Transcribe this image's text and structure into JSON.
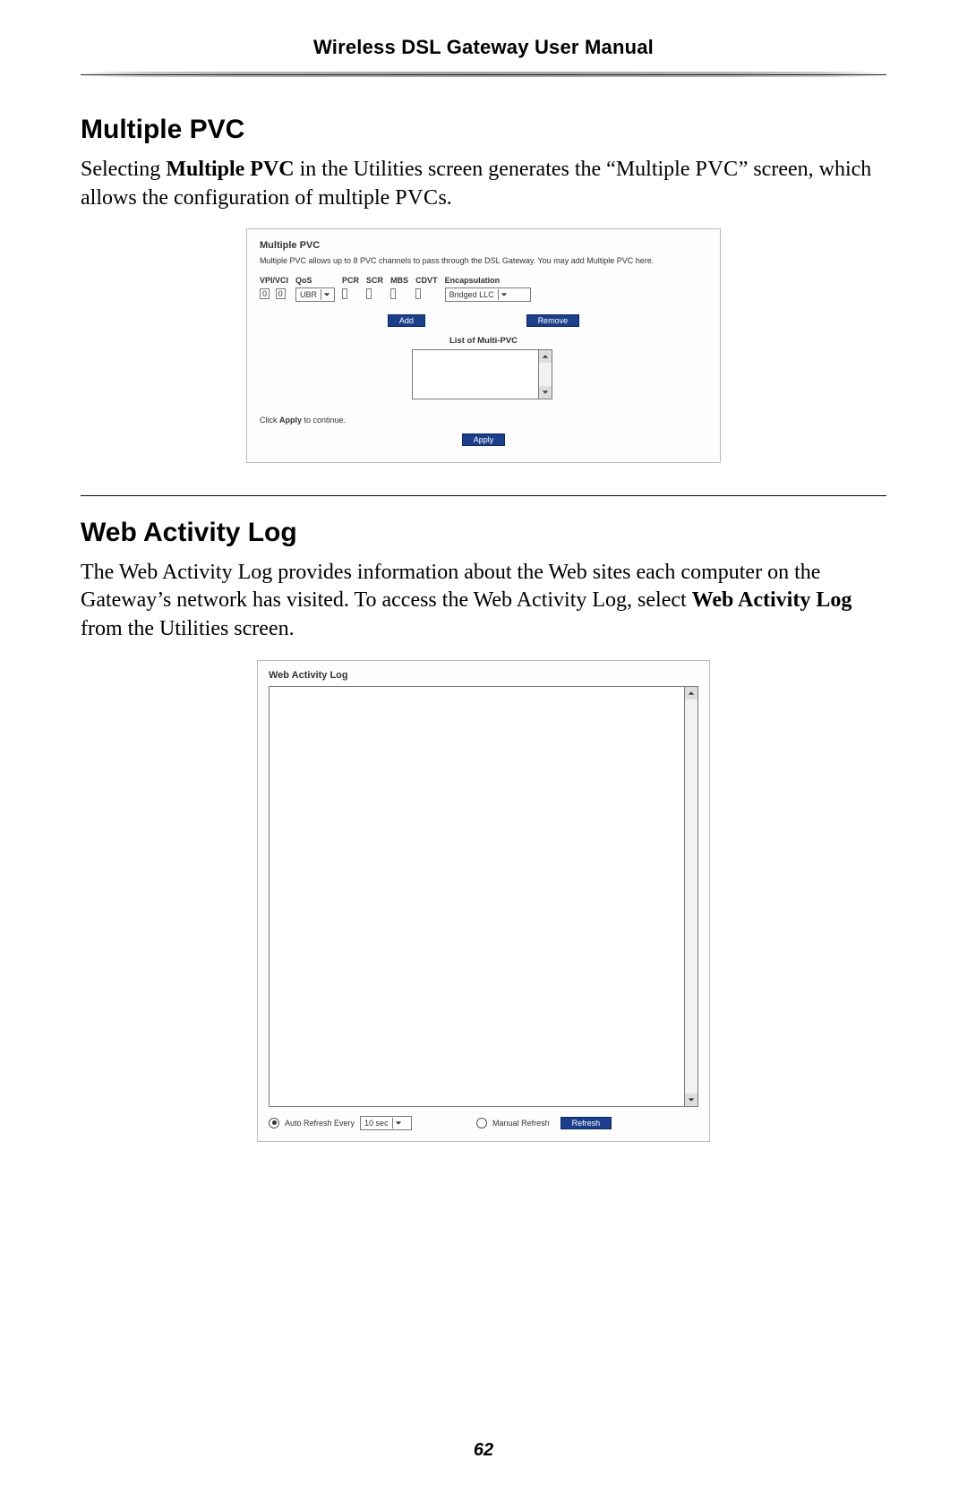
{
  "header": {
    "title": "Wireless DSL Gateway User Manual"
  },
  "page_number": "62",
  "sections": {
    "pvc": {
      "heading": "Multiple PVC",
      "para_a": "Selecting ",
      "para_b_strong": "Multiple PVC",
      "para_c": " in the Utilities screen generates the “Multiple ",
      "para_d_sc": "PVC",
      "para_e": "” screen, which allows the configuration of multiple ",
      "para_f_sc": "PVC",
      "para_g": "s."
    },
    "log": {
      "heading": "Web Activity Log",
      "para_a": "The Web Activity Log provides information about the Web sites each computer on the Gateway’s network has visited. To access the Web Activity Log, select ",
      "para_b_strong": "Web Activity Log",
      "para_c": " from the Utilities screen."
    }
  },
  "pvc_panel": {
    "title": "Multiple PVC",
    "intro": "Multiple PVC allows up to 8 PVC channels to pass through the DSL Gateway. You may add Multiple PVC here.",
    "cols": {
      "vpi_vci": "VPI/VCI",
      "qos": "QoS",
      "pcr": "PCR",
      "scr": "SCR",
      "mbs": "MBS",
      "cdvt": "CDVT",
      "encap": "Encapsulation"
    },
    "vals": {
      "vpi": "0",
      "vci": "0",
      "qos": "UBR",
      "pcr": "",
      "scr": "",
      "mbs": "",
      "cdvt": "",
      "encap": "Bridged LLC"
    },
    "add": "Add",
    "remove": "Remove",
    "list_title": "List of Multi-PVC",
    "footnote_a": "Click ",
    "footnote_b": "Apply",
    "footnote_c": " to continue.",
    "apply": "Apply"
  },
  "log_panel": {
    "title": "Web Activity Log",
    "auto_label": "Auto Refresh Every",
    "interval": "10 sec",
    "manual_label": "Manual Refresh",
    "refresh": "Refresh"
  }
}
